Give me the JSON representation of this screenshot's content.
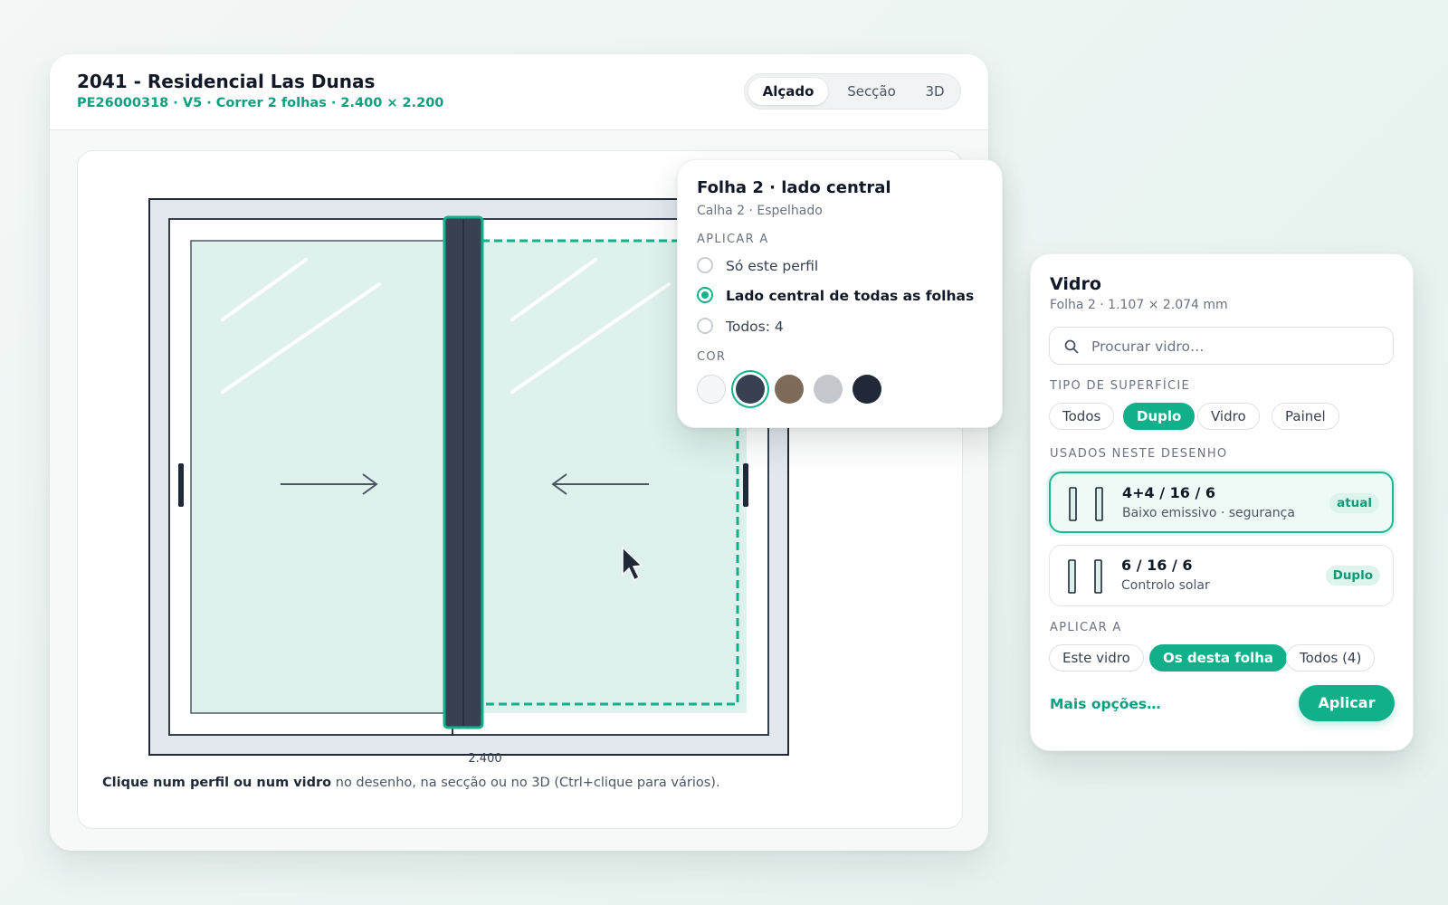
{
  "header": {
    "title": "2041 - Residencial Las Dunas",
    "subtitle": "PE26000318 · V5 · Correr 2 folhas · 2.400 × 2.200",
    "view_tabs": [
      {
        "label": "Alçado",
        "active": true
      },
      {
        "label": "Secção",
        "active": false
      },
      {
        "label": "3D",
        "active": false
      }
    ]
  },
  "drawing": {
    "width_dimension": "2.400",
    "hint_bold": "Clique num perfil ou num vidro",
    "hint_rest": " no desenho, na secção ou no 3D (Ctrl+clique para vários)."
  },
  "profile_popover": {
    "title": "Folha 2 · lado central",
    "subtitle": "Calha 2 · Espelhado",
    "apply_label": "APLICAR A",
    "options": [
      {
        "label": "Só este perfil",
        "checked": false
      },
      {
        "label": "Lado central de todas as folhas",
        "checked": true
      },
      {
        "label": "Todos: 4",
        "checked": false
      }
    ],
    "color_label": "COR",
    "colors": [
      "#f6f7f8",
      "#374151",
      "#7d6a58",
      "#c4c8cd",
      "#1f2937"
    ],
    "selected_color_index": 1
  },
  "glass_panel": {
    "title": "Vidro",
    "subtitle": "Folha 2 · 1.107 × 2.074 mm",
    "search_placeholder": "Procurar vidro…",
    "surface_label": "TIPO DE SUPERFÍCIE",
    "surface_chips": [
      {
        "label": "Todos",
        "active": false
      },
      {
        "label": "Duplo",
        "active": true
      },
      {
        "label": "Vidro",
        "active": false
      },
      {
        "label": "Painel",
        "active": false
      }
    ],
    "used_label": "USADOS NESTE DESENHO",
    "items": [
      {
        "name": "4+4 / 16 / 6",
        "desc": "Baixo emissivo · segurança",
        "badge": "atual",
        "current": true
      },
      {
        "name": "6 / 16 / 6",
        "desc": "Controlo solar",
        "badge": "Duplo",
        "current": false
      }
    ],
    "apply_label": "APLICAR A",
    "apply_chips": [
      {
        "label": "Este vidro",
        "active": false
      },
      {
        "label": "Os desta folha",
        "active": true
      },
      {
        "label": "Todos (4)",
        "active": false
      }
    ],
    "more_link": "Mais opções…",
    "apply_button": "Aplicar"
  },
  "colors": {
    "accent": "#12b08a",
    "glass_fill": "#dff1ec",
    "frame_fill": "#e3e7ee",
    "profile_dark": "#374151"
  }
}
